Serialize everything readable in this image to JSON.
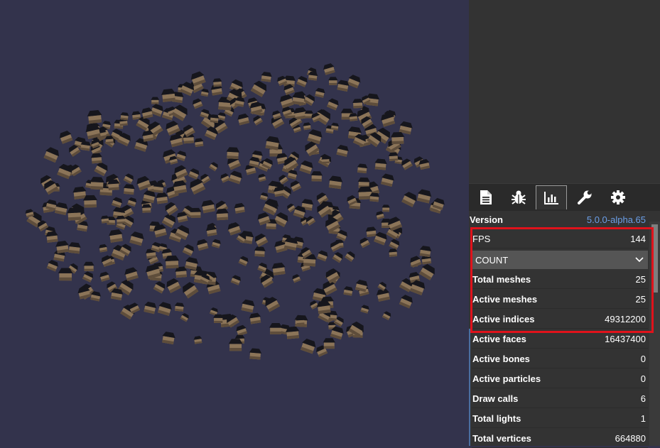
{
  "inspector": {
    "tabs": [
      {
        "name": "statistics-document",
        "icon": "file-icon"
      },
      {
        "name": "debug",
        "icon": "bug-icon"
      },
      {
        "name": "statistics",
        "icon": "bar-chart-icon",
        "active": true
      },
      {
        "name": "tools",
        "icon": "wrench-icon"
      },
      {
        "name": "settings",
        "icon": "gear-icon"
      }
    ],
    "version": {
      "label": "Version",
      "value": "5.0.0-alpha.65"
    },
    "fps": {
      "label": "FPS",
      "value": "144"
    },
    "count_section": {
      "title": "COUNT",
      "icon": "chevron-down-icon"
    },
    "rows": [
      {
        "label": "Total meshes",
        "value": "25"
      },
      {
        "label": "Active meshes",
        "value": "25"
      },
      {
        "label": "Active indices",
        "value": "49312200"
      },
      {
        "label": "Active faces",
        "value": "16437400"
      },
      {
        "label": "Active bones",
        "value": "0"
      },
      {
        "label": "Active particles",
        "value": "0"
      },
      {
        "label": "Draw calls",
        "value": "6"
      },
      {
        "label": "Total lights",
        "value": "1"
      },
      {
        "label": "Total vertices",
        "value": "664880"
      }
    ]
  },
  "colors": {
    "scene_background": "#33334c",
    "panel_background": "#333333",
    "highlight": "#e0121b",
    "version_value": "#6b9fe8"
  }
}
